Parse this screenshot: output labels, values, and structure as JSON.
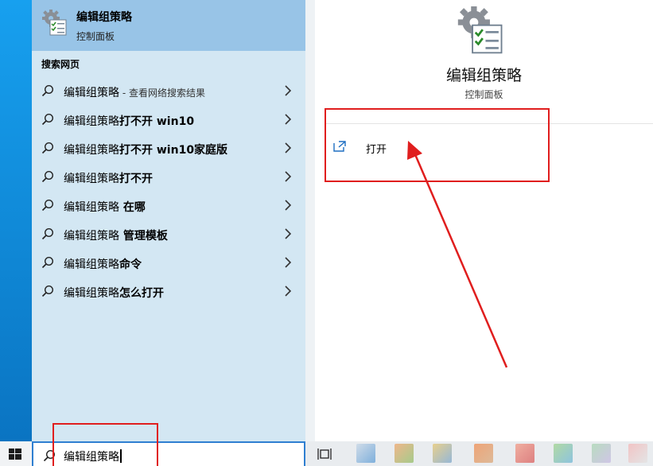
{
  "best_match": {
    "title": "编辑组策略",
    "subtitle": "控制面板",
    "icon": "group-policy-icon"
  },
  "web_section": {
    "title": "搜索网页"
  },
  "results": [
    {
      "text": "编辑组策略",
      "suffix": "",
      "hint": " - 查看网络搜索结果"
    },
    {
      "text": "编辑组策略",
      "suffix": "打不开 win10",
      "hint": ""
    },
    {
      "text": "编辑组策略",
      "suffix": "打不开 win10家庭版",
      "hint": ""
    },
    {
      "text": "编辑组策略",
      "suffix": "打不开",
      "hint": ""
    },
    {
      "text": "编辑组策略",
      "suffix": " 在哪",
      "hint": ""
    },
    {
      "text": "编辑组策略",
      "suffix": " 管理模板",
      "hint": ""
    },
    {
      "text": "编辑组策略",
      "suffix": "命令",
      "hint": ""
    },
    {
      "text": "编辑组策略",
      "suffix": "怎么打开",
      "hint": ""
    }
  ],
  "detail": {
    "title": "编辑组策略",
    "subtitle": "控制面板",
    "open_label": "打开",
    "open_icon": "open-external-icon"
  },
  "taskbar": {
    "search_value": "编辑组策略",
    "start_icon": "windows-logo-icon",
    "task_view_icon": "task-view-icon"
  },
  "colors": {
    "annotation": "#e01e1e",
    "best_match_bg": "#98c4e7",
    "results_bg": "#d3e7f3",
    "search_border": "#2f7fd1"
  }
}
